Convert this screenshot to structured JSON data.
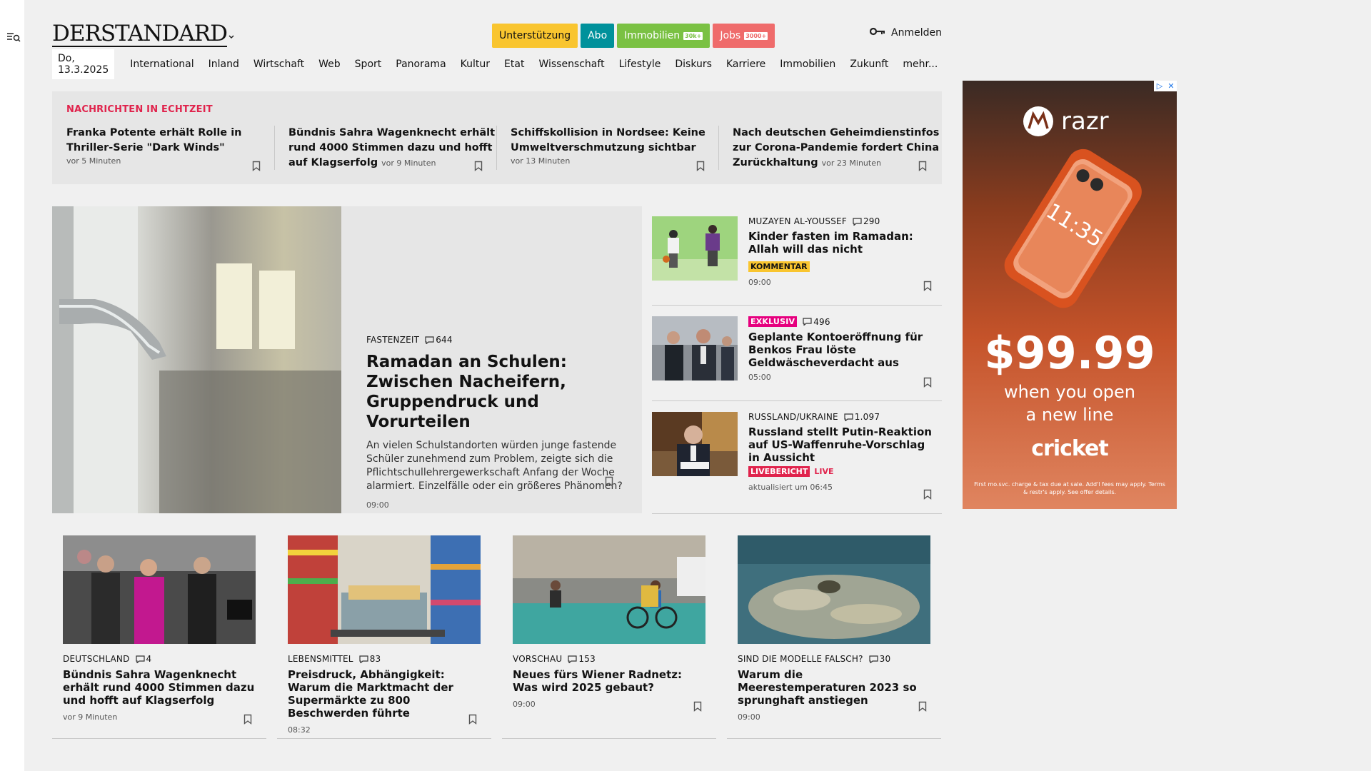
{
  "logo": "DERSTANDARD",
  "header": {
    "pills": [
      {
        "label": "Unterstützung",
        "bg": "#f9c52f",
        "fg": "#121212",
        "tag": ""
      },
      {
        "label": "Abo",
        "bg": "#00919b",
        "fg": "#ffffff",
        "tag": ""
      },
      {
        "label": "Immobilien",
        "bg": "#7ac143",
        "fg": "#ffffff",
        "tag": "30k+"
      },
      {
        "label": "Jobs",
        "bg": "#ef6b6b",
        "fg": "#ffffff",
        "tag": "3000+"
      }
    ],
    "login": "Anmelden"
  },
  "nav": {
    "date": "Do, 13.3.2025",
    "items": [
      "International",
      "Inland",
      "Wirtschaft",
      "Web",
      "Sport",
      "Panorama",
      "Kultur",
      "Etat",
      "Wissenschaft",
      "Lifestyle",
      "Diskurs",
      "Karriere",
      "Immobilien",
      "Zukunft",
      "mehr..."
    ]
  },
  "realtime": {
    "title": "NACHRICHTEN IN ECHTZEIT",
    "items": [
      {
        "headline": "Franka Potente erhält Rolle in Thriller-Serie \"Dark Winds\"",
        "time": "vor 5 Minuten"
      },
      {
        "headline": "Bündnis Sahra Wagenknecht erhält rund 4000 Stimmen dazu und hofft auf Klagserfolg",
        "time": "vor 9 Minuten"
      },
      {
        "headline": "Schiffskollision in Nordsee: Keine Umweltverschmutzung sichtbar",
        "time": "vor 13 Minuten"
      },
      {
        "headline": "Nach deutschen Geheimdienstinfos zur Corona-Pandemie fordert China Zurückhaltung",
        "time": "vor 23 Minuten"
      }
    ]
  },
  "lead": {
    "kicker": "FASTENZEIT",
    "comments": "644",
    "headline": "Ramadan an Schulen: Zwischen Nacheifern, Gruppendruck und Vorurteilen",
    "teaser": "An vielen Schulstandorten würden junge fastende Schüler zunehmend zum Problem, zeigte sich die Pflichtschullehrergewerkschaft Anfang der Woche alarmiert. Einzelfälle oder ein größeres Phänomen?",
    "time": "09:00"
  },
  "side": [
    {
      "kicker": "MUZAYEN AL-YOUSSEF",
      "comments": "290",
      "headline": "Kinder fasten im Ramadan: Allah will das nicht",
      "badge": "KOMMENTAR",
      "time": "09:00"
    },
    {
      "badge": "EXKLUSIV",
      "comments": "496",
      "headline": "Geplante Kontoeröffnung für Benkos Frau löste Geldwäscheverdacht aus",
      "time": "05:00"
    },
    {
      "kicker": "RUSSLAND/UKRAINE",
      "comments": "1.097",
      "headline": "Russland stellt Putin-Reaktion auf US-Waffenruhe-Vorschlag in Aussicht",
      "badge": "LIVEBERICHT",
      "live": "LIVE",
      "time": "aktualisiert um 06:45"
    }
  ],
  "cards": [
    {
      "kicker": "DEUTSCHLAND",
      "comments": "4",
      "headline": "Bündnis Sahra Wagenknecht erhält rund 4000 Stimmen dazu und hofft auf Klagserfolg",
      "time": "vor 9 Minuten"
    },
    {
      "kicker": "LEBENSMITTEL",
      "comments": "83",
      "headline": "Preisdruck, Abhängigkeit: Warum die Marktmacht der Supermärkte zu 800 Beschwerden führte",
      "time": "08:32"
    },
    {
      "kicker": "VORSCHAU",
      "comments": "153",
      "headline": "Neues fürs Wiener Radnetz: Was wird 2025 gebaut?",
      "time": "09:00"
    },
    {
      "kicker": "SIND DIE MODELLE FALSCH?",
      "comments": "30",
      "headline": "Warum die Meerestemperaturen 2023 so sprunghaft anstiegen",
      "time": "09:00"
    }
  ],
  "ad": {
    "brand": "razr",
    "phone_time": "11:35",
    "price": "$99.99",
    "sub1": "when you open",
    "sub2": "a new line",
    "cricket": "cricket",
    "fine": "First mo.svc. charge & tax due at sale. Add'l fees may apply. Terms & restr's apply. See offer details."
  },
  "colors": {
    "accent_red": "#e0234c",
    "badge_yellow": "#f9c52f",
    "badge_magenta": "#e6007e"
  }
}
